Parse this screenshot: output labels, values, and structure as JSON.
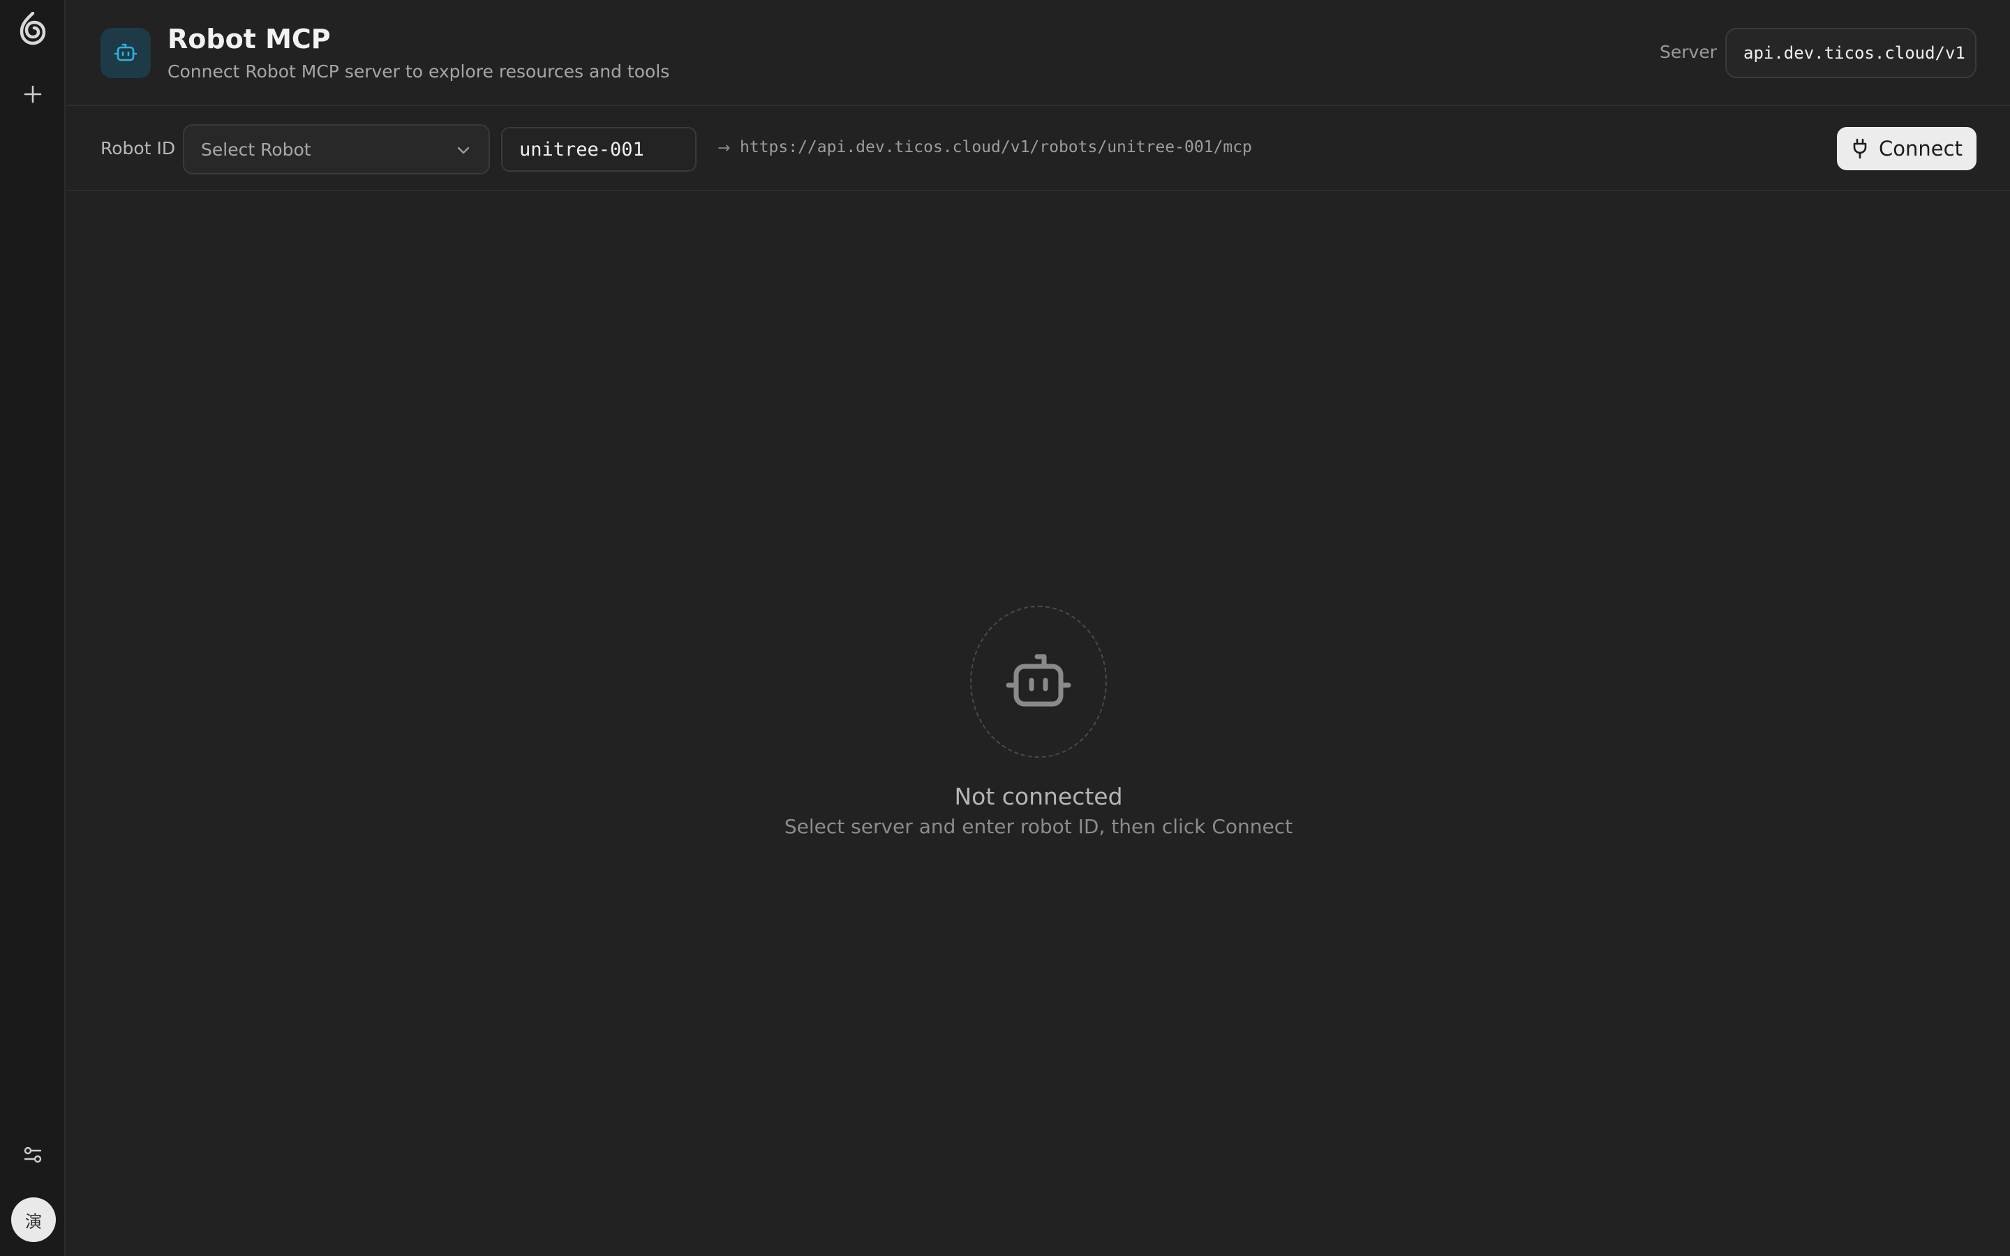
{
  "sidebar": {
    "logo_icon": "swirl-logo-icon",
    "new_icon": "plus-icon",
    "settings_icon": "sliders-icon",
    "avatar_text": "演"
  },
  "header": {
    "title": "Robot MCP",
    "subtitle": "Connect Robot MCP server to explore resources and tools",
    "icon": "robot-icon",
    "accent_color": "#2bb3d9",
    "server_label": "Server",
    "server_value": "api.dev.ticos.cloud/v1"
  },
  "toolbar": {
    "robot_id_label": "Robot ID",
    "robot_select_placeholder": "Select Robot",
    "robot_id_value": "unitree-001",
    "endpoint_arrow": "→",
    "endpoint_url": "https://api.dev.ticos.cloud/v1/robots/unitree-001/mcp",
    "connect_label": "Connect",
    "connect_icon": "plug-icon"
  },
  "empty_state": {
    "icon": "robot-icon",
    "title": "Not connected",
    "subtitle": "Select server and enter robot ID, then click Connect"
  }
}
